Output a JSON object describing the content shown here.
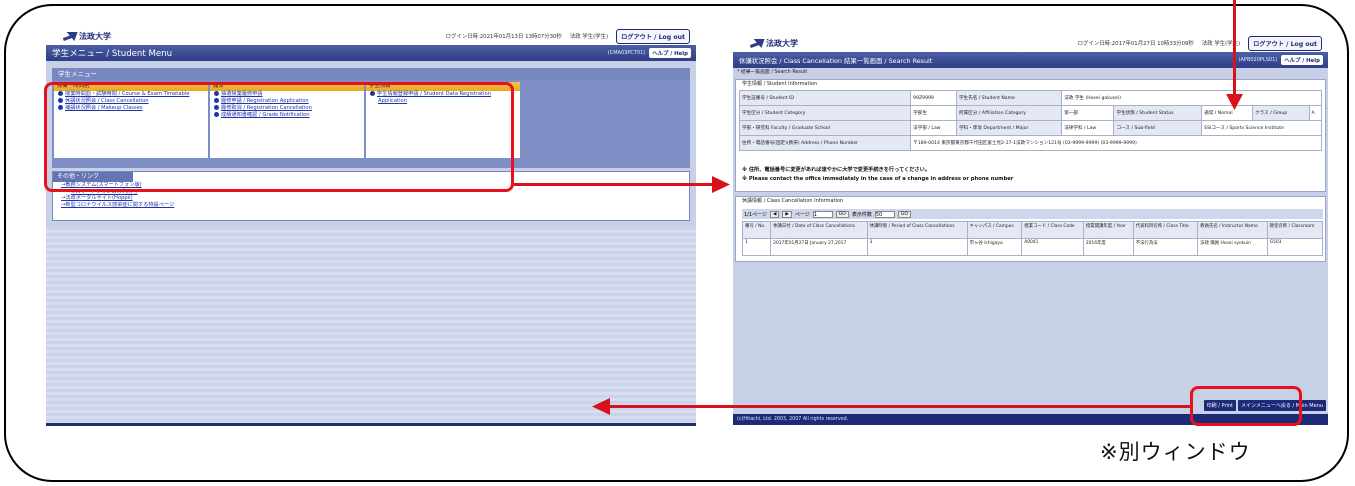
{
  "left_window": {
    "logo": "法政大学",
    "login_info": "ログイン日時:2021年01月13日 13時07分30秒",
    "user": "法政 学生(学生)",
    "logout_label": "ログアウト / Log out",
    "title": "学生メニュー / Student Menu",
    "screen_code": "(CMA03PCT01)",
    "help_label": "ヘルプ / Help",
    "menu_header": "学生メニュー",
    "columns": [
      {
        "heading": "授業・時間割",
        "links": [
          "授業時間割・試験時間 / Course & Exam Timetable",
          "休講状況照会 / Class Cancellation",
          "補講状況照会 / Makeup Classes"
        ]
      },
      {
        "heading": "履修",
        "links": [
          "抽選授業履修申請",
          "履修申請 / Registration Application",
          "履修取消 / Registration Cancellation",
          "成績通知書確認 / Grade Notification"
        ]
      },
      {
        "heading": "学生情報",
        "links": [
          "学生情報登録申請 / Student Data Registration",
          "Application"
        ]
      }
    ],
    "other_header": "その他・リンク",
    "other_links": [
      "→教務システム(スマートフォン版)",
      "※スマートフォンのみ利用可",
      "→法政ポータルサイト(Hoppii)",
      "→新型コロナウイルス感染症に関する特設ページ"
    ]
  },
  "right_window": {
    "logo": "法政大学",
    "login_info": "ログイン日時:2017年01月27日 10時33分09秒",
    "user": "法政 学生(学生)",
    "logout_label": "ログアウト / Log out",
    "title": "休講状況照会 / Class Cancellation 結果一覧画面 / Search Result",
    "screen_code": "(APB020PLS01)",
    "help_label": "ヘルプ / Help",
    "breadcrumb": "* 結果一覧画面 / Search Result",
    "student_section_title": "学生情報 / Student Information",
    "student_rows": [
      [
        "学生証番号 / Student ID",
        "99Z9999",
        "学生氏名 / Student Name",
        "法政 学生 (Hosei gakusei)",
        "",
        "",
        "",
        ""
      ],
      [
        "学生区分 / Student Category",
        "学部生",
        "所属区分 / Affiliation Category",
        "第一部",
        "学生状態 / Student Status",
        "通常 / Nomal",
        "クラス / Group",
        "A"
      ],
      [
        "学部・研究科 Faculty / Graduate School",
        "法学部 / Law",
        "学科・専攻 Department / Major",
        "法律学科 / Law",
        "コース / Sub-field",
        "SSIコース / Sports Science Institute",
        "",
        ""
      ]
    ],
    "address_label": "住所・電話番号(固定)(携帯) Address / Phone Number",
    "address_value": "〒189-0014 東京都東京都千代田区富士見2-17-1法政マンション121号 (03-9999-9999) (03-9999-9999)",
    "notice_ja": "※ 住所、電話番号に変更があれば速やかに大学で変更手続きを行ってください。",
    "notice_en": "※ Please contact the office immediately in the case of a change in address or phone number",
    "cancel_section_title": "休講情報 / Class Cancellation Information",
    "pager": {
      "page": "1/1ページ",
      "page_label": "ページ",
      "page_input": "1",
      "go": "GO",
      "per_page_label": "表示件数",
      "per_page": "50",
      "go2": "GO"
    },
    "cancel_headers": [
      "番号 / No.",
      "休講日付 / Date of Class Cancellations",
      "休講時限 / Period of Class Cancellations",
      "キャンパス / Campus",
      "授業コード / Class Code",
      "授業開講年度 / Year",
      "代表科目名称 / Class Title",
      "教員氏名 / Instructor Name",
      "教室名称 / Classroom"
    ],
    "cancel_rows": [
      [
        "1",
        "2017年01月27日 January 27,2017",
        "3",
        "市ヶ谷 Ichigaya",
        "A0041",
        "2016年度",
        "不法行為法",
        "法政 職員 Hosei syokuin",
        "G503"
      ]
    ],
    "print_label": "印刷 / Print",
    "back_label": "メインメニューへ戻る / Main Menu",
    "copyright": "(c)Hitachi, Ltd. 2003, 2007 All rights reserved."
  },
  "caption": "※別ウィンドウ",
  "highlight_color": "#e8101a"
}
